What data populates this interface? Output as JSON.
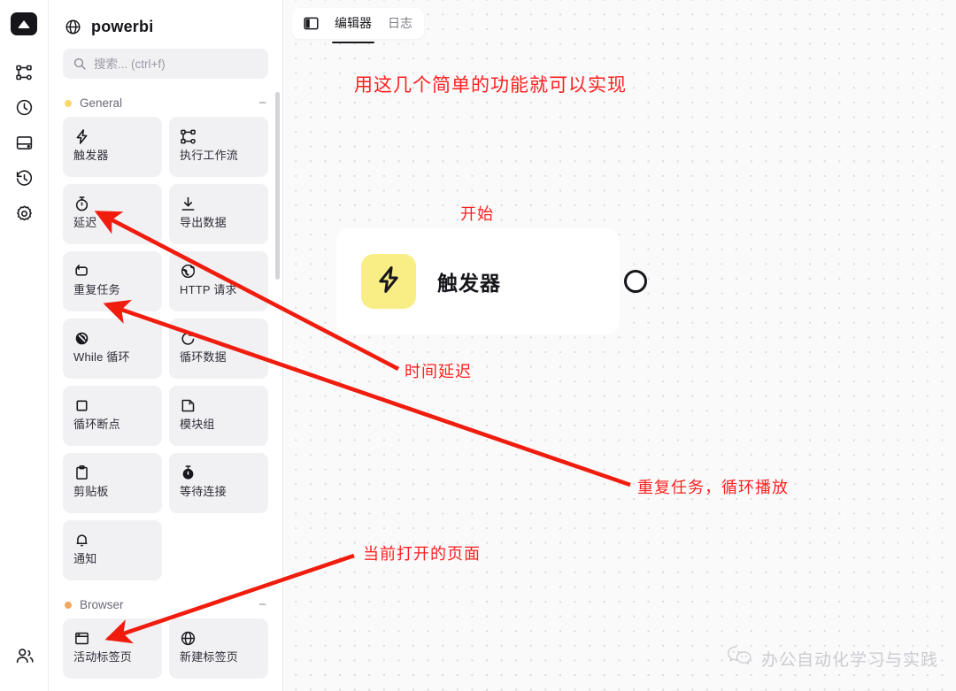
{
  "rail": {
    "logo_icon": "app-logo-triangle-icon",
    "items": [
      {
        "icon": "workflow-nodes-icon",
        "name": "workflow"
      },
      {
        "icon": "clock-icon",
        "name": "schedule"
      },
      {
        "icon": "database-icon",
        "name": "storage"
      },
      {
        "icon": "history-clock-arrow-icon",
        "name": "history"
      },
      {
        "icon": "gear-icon",
        "name": "settings"
      }
    ],
    "bottom_item": {
      "icon": "users-icon",
      "name": "account"
    }
  },
  "sidebar": {
    "title": "powerbi",
    "title_icon": "globe-icon",
    "search": {
      "placeholder": "搜索... (ctrl+f)",
      "value": "",
      "icon": "search-icon"
    },
    "groups": [
      {
        "name": "General",
        "dot_color": "#f6d96a",
        "collapse_label": "−",
        "items": [
          {
            "label": "触发器",
            "icon": "lightning-bolt-icon"
          },
          {
            "label": "执行工作流",
            "icon": "workflow-nodes-icon"
          },
          {
            "label": "延迟",
            "icon": "stopwatch-icon"
          },
          {
            "label": "导出数据",
            "icon": "download-icon"
          },
          {
            "label": "重复任务",
            "icon": "repeat-loop-icon"
          },
          {
            "label": "HTTP 请求",
            "icon": "globe-network-icon"
          },
          {
            "label": "While 循环",
            "icon": "while-loop-icon"
          },
          {
            "label": "循环数据",
            "icon": "refresh-cycle-icon"
          },
          {
            "label": "循环断点",
            "icon": "square-stop-icon"
          },
          {
            "label": "模块组",
            "icon": "folder-module-icon"
          },
          {
            "label": "剪贴板",
            "icon": "clipboard-icon"
          },
          {
            "label": "等待连接",
            "icon": "stopwatch-wait-icon"
          },
          {
            "label": "通知",
            "icon": "bell-icon"
          }
        ]
      },
      {
        "name": "Browser",
        "dot_color": "#f0a860",
        "collapse_label": "−",
        "items": [
          {
            "label": "活动标签页",
            "icon": "browser-window-icon"
          },
          {
            "label": "新建标签页",
            "icon": "globe-icon"
          }
        ]
      }
    ]
  },
  "toolbar": {
    "panel_toggle_icon": "panel-toggle-icon",
    "tabs": [
      {
        "label": "编辑器",
        "active": true
      },
      {
        "label": "日志",
        "active": false
      }
    ]
  },
  "canvas": {
    "node": {
      "label": "触发器",
      "icon": "lightning-bolt-icon",
      "icon_bg": "#f9ed85",
      "port_name": "output-port"
    },
    "annotations": [
      {
        "id": "title",
        "text": "用这几个简单的功能就可以实现",
        "color": "#ff2020"
      },
      {
        "id": "start",
        "text": "开始",
        "color": "#ff2020"
      },
      {
        "id": "delay",
        "text": "时间延迟",
        "color": "#ff2020"
      },
      {
        "id": "repeat",
        "text": "重复任务，循环播放",
        "color": "#ff2020"
      },
      {
        "id": "page",
        "text": "当前打开的页面",
        "color": "#ff2020"
      }
    ],
    "watermark": {
      "text": "办公自动化学习与实践",
      "icon": "wechat-icon"
    }
  }
}
